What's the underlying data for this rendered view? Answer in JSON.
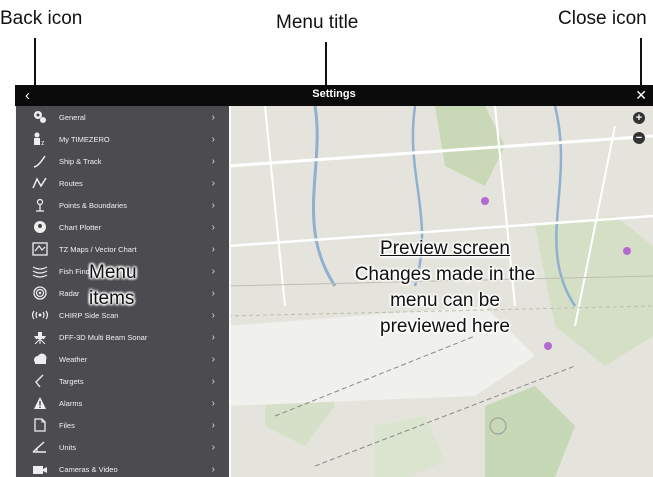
{
  "callouts": {
    "back": "Back icon",
    "title": "Menu title",
    "close": "Close icon"
  },
  "header": {
    "title": "Settings",
    "back_icon": "‹",
    "close_icon": "✕"
  },
  "map_controls": {
    "zoom_in": "+",
    "zoom_out": "−"
  },
  "menu": {
    "items": [
      {
        "label": "General",
        "icon": "gears-icon"
      },
      {
        "label": "My TIMEZERO",
        "icon": "user-tz-icon"
      },
      {
        "label": "Ship & Track",
        "icon": "track-icon"
      },
      {
        "label": "Routes",
        "icon": "routes-icon"
      },
      {
        "label": "Points & Boundaries",
        "icon": "points-icon"
      },
      {
        "label": "Chart Plotter",
        "icon": "plotter-icon"
      },
      {
        "label": "TZ Maps / Vector Chart",
        "icon": "map-icon"
      },
      {
        "label": "Fish Finder",
        "icon": "fish-finder-icon"
      },
      {
        "label": "Radar",
        "icon": "radar-icon"
      },
      {
        "label": "CHIRP Side Scan",
        "icon": "side-scan-icon"
      },
      {
        "label": "DFF-3D Multi Beam Sonar",
        "icon": "sonar-icon"
      },
      {
        "label": "Weather",
        "icon": "weather-icon"
      },
      {
        "label": "Targets",
        "icon": "targets-icon"
      },
      {
        "label": "Alarms",
        "icon": "alarm-icon"
      },
      {
        "label": "Files",
        "icon": "files-icon"
      },
      {
        "label": "Units",
        "icon": "units-icon"
      },
      {
        "label": "Cameras & Video",
        "icon": "camera-icon"
      }
    ],
    "chevron": "›"
  },
  "annotations": {
    "menu_note_line1": "Menu",
    "menu_note_line2": "items",
    "preview_heading": "Preview screen",
    "preview_line1": "Changes made in the",
    "preview_line2": "menu can be",
    "preview_line3": "previewed here"
  }
}
